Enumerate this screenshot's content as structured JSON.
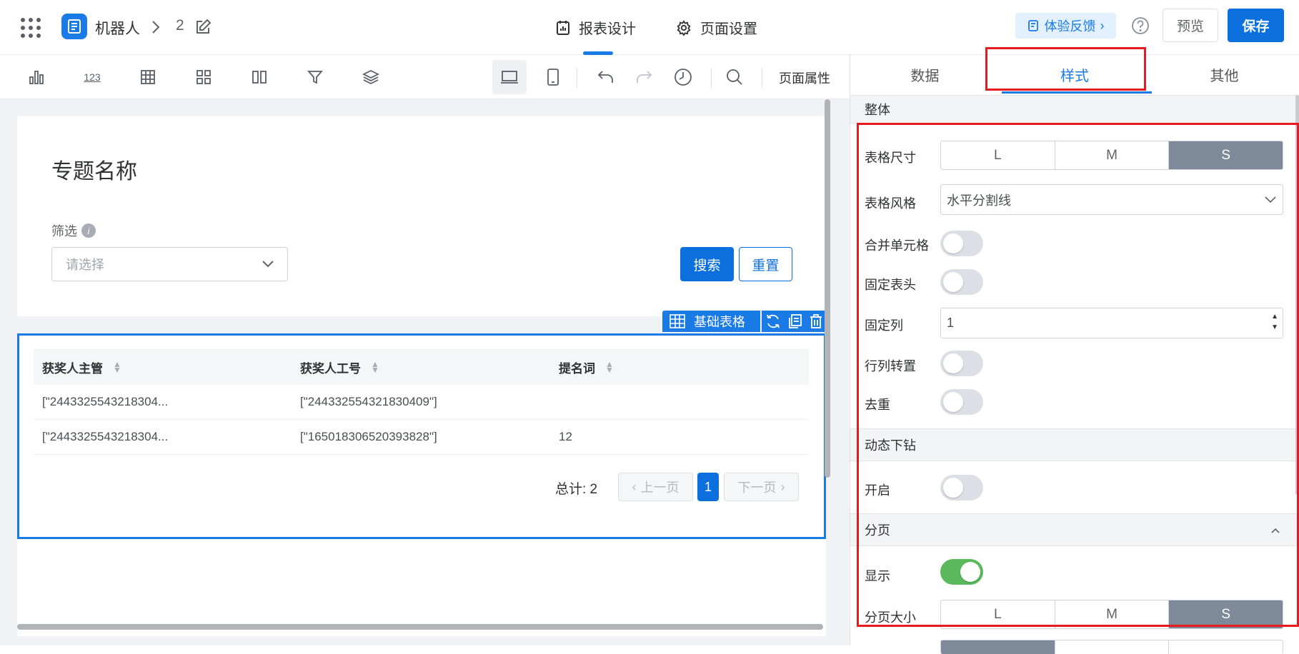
{
  "header": {
    "app_name": "机器人",
    "page_number": "2",
    "tabs": [
      {
        "label": "报表设计",
        "icon": "report-icon",
        "active": true
      },
      {
        "label": "页面设置",
        "icon": "gear-icon",
        "active": false
      }
    ],
    "feedback_label": "体验反馈",
    "preview_label": "预览",
    "save_label": "保存"
  },
  "toolbar": {
    "tools": [
      "bar-chart-icon",
      "number-icon",
      "table-icon",
      "grid-icon",
      "columns-icon",
      "filter-icon",
      "layers-icon"
    ],
    "number_text": "123",
    "view_tools": [
      "desktop-icon",
      "mobile-icon",
      "undo-icon",
      "redo-icon",
      "history-icon",
      "search-icon"
    ],
    "page_props_label": "页面属性"
  },
  "canvas": {
    "title": "专题名称",
    "filter_label": "筛选",
    "filter_placeholder": "请选择",
    "search_label": "搜索",
    "reset_label": "重置",
    "component_label": "基础表格",
    "table": {
      "columns": [
        "获奖人主管",
        "获奖人工号",
        "提名词"
      ],
      "rows": [
        [
          "[\"2443325543218304...",
          "[\"244332554321830409\"]",
          ""
        ],
        [
          "[\"2443325543218304...",
          "[\"165018306520393828\"]",
          "12"
        ]
      ]
    },
    "pagination": {
      "total_label": "总计: 2",
      "prev_label": "上一页",
      "next_label": "下一页",
      "current_page": "1"
    }
  },
  "panel": {
    "tabs": [
      "数据",
      "样式",
      "其他"
    ],
    "active_tab": "样式",
    "sections": {
      "overall": "整体",
      "drill": "动态下钻",
      "paging": "分页"
    },
    "table_size_label": "表格尺寸",
    "size_options": [
      "L",
      "M",
      "S"
    ],
    "table_style_label": "表格风格",
    "table_style_value": "水平分割线",
    "merge_cells_label": "合并单元格",
    "fixed_header_label": "固定表头",
    "fixed_column_label": "固定列",
    "fixed_column_value": "1",
    "transpose_label": "行列转置",
    "dedupe_label": "去重",
    "drill_enable_label": "开启",
    "paging_show_label": "显示",
    "page_size_label": "分页大小",
    "colors": {
      "primary": "#0c6fde",
      "toggle_on": "#5cb85c",
      "highlight": "#e8191f"
    }
  }
}
